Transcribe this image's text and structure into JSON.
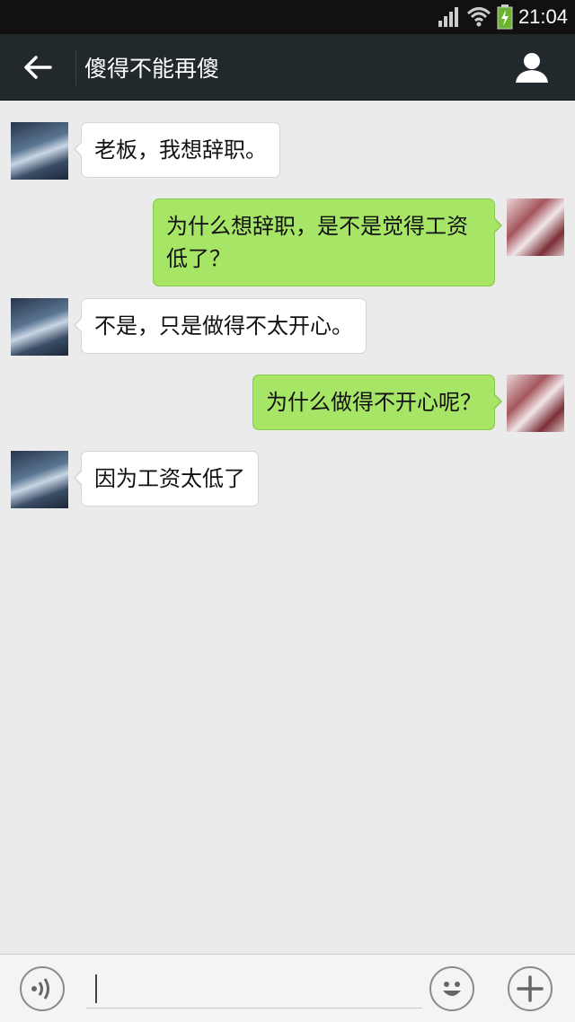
{
  "status_bar": {
    "time": "21:04"
  },
  "header": {
    "title": "傻得不能再傻"
  },
  "messages": [
    {
      "side": "left",
      "text": "老板，我想辞职。"
    },
    {
      "side": "right",
      "text": "为什么想辞职，是不是觉得工资低了？"
    },
    {
      "side": "left",
      "text": "不是，只是做得不太开心。"
    },
    {
      "side": "right",
      "text": "为什么做得不开心呢？"
    },
    {
      "side": "left",
      "text": "因为工资太低了"
    }
  ],
  "input": {
    "value": "",
    "placeholder": ""
  },
  "icons": {
    "back": "arrow-left-icon",
    "profile": "person-icon",
    "voice": "voice-icon",
    "emoji": "smiley-icon",
    "more": "plus-icon"
  },
  "colors": {
    "titlebar": "#22292c",
    "chat_bg": "#ebebeb",
    "incoming_bubble": "#ffffff",
    "outgoing_bubble": "#a7e567"
  }
}
